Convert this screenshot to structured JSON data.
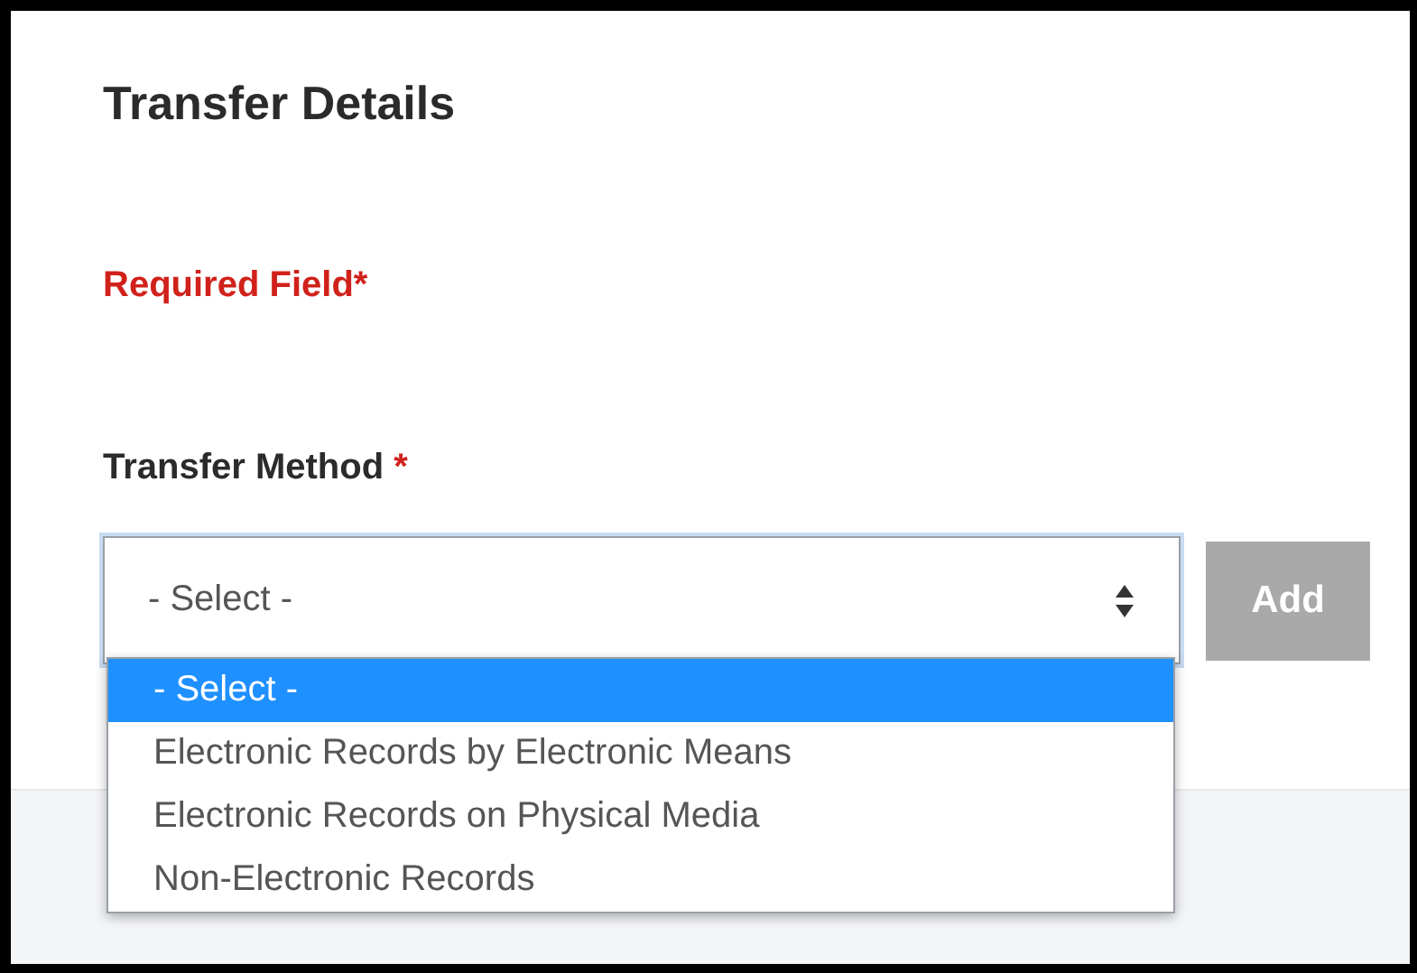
{
  "section": {
    "title": "Transfer Details"
  },
  "required_note": {
    "label": "Required Field",
    "marker": "*"
  },
  "field": {
    "label": "Transfer Method",
    "marker": "*",
    "value": "- Select -",
    "expanded": true,
    "options": [
      {
        "label": "- Select -",
        "selected": true
      },
      {
        "label": "Electronic Records by Electronic Means",
        "selected": false
      },
      {
        "label": "Electronic Records on Physical Media",
        "selected": false
      },
      {
        "label": "Non-Electronic Records",
        "selected": false
      }
    ]
  },
  "add_button": {
    "label": "Add",
    "disabled": true
  }
}
